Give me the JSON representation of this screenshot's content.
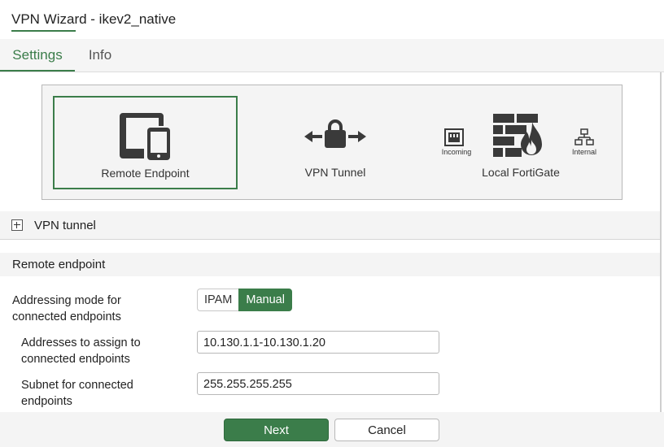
{
  "window": {
    "title": "VPN Wizard - ikev2_native"
  },
  "tabs": [
    {
      "label": "Settings",
      "active": true
    },
    {
      "label": "Info",
      "active": false
    }
  ],
  "diagram": {
    "remote_endpoint": {
      "label": "Remote Endpoint",
      "icon": "devices-icon",
      "selected": true
    },
    "vpn_tunnel": {
      "label": "VPN Tunnel",
      "icon": "lock-arrows-icon"
    },
    "local_fortigate": {
      "label": "Local FortiGate",
      "icon": "firewall-icon",
      "incoming": "Incoming",
      "internal": "Internal"
    }
  },
  "sections": {
    "vpn_tunnel": "VPN tunnel",
    "remote_endpoint": "Remote endpoint"
  },
  "form": {
    "addressing_mode": {
      "label_line1": "Addressing mode for",
      "label_line2": "connected endpoints",
      "options": [
        "IPAM",
        "Manual"
      ],
      "selected": "Manual"
    },
    "addresses": {
      "label_line1": "Addresses to assign to",
      "label_line2": "connected endpoints",
      "value": "10.130.1.1-10.130.1.20"
    },
    "subnet": {
      "label_line1": "Subnet for connected",
      "label_line2": "endpoints",
      "value": "255.255.255.255"
    }
  },
  "footer": {
    "next_label": "Next",
    "cancel_label": "Cancel"
  },
  "colors": {
    "accent": "#3b7d4a",
    "icon": "#3a3a3a"
  }
}
